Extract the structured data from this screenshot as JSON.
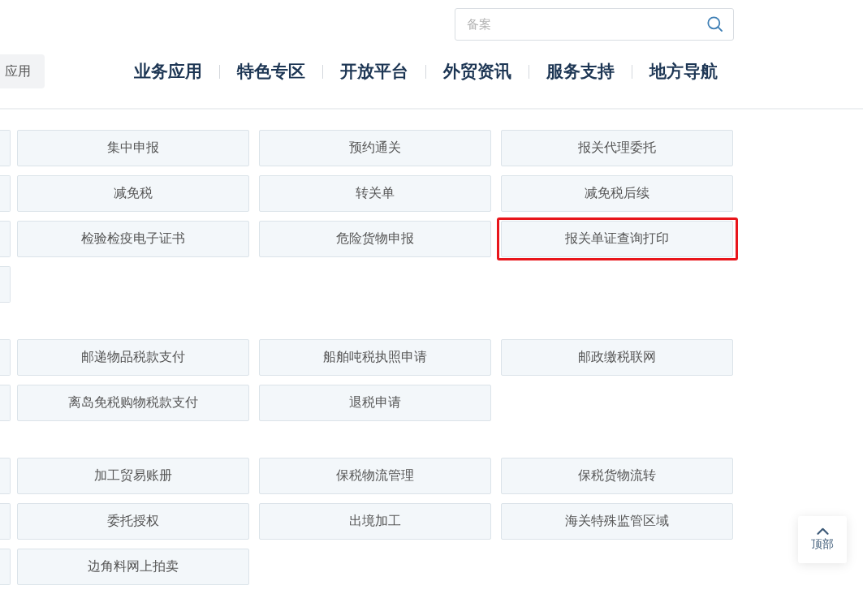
{
  "search": {
    "placeholder": "备案"
  },
  "category_tab": {
    "label": "应用"
  },
  "nav": [
    "业务应用",
    "特色专区",
    "开放平台",
    "外贸资讯",
    "服务支持",
    "地方导航"
  ],
  "groups": [
    {
      "rows": [
        {
          "cells": [
            {
              "kind": "clipped"
            },
            {
              "kind": "tile",
              "label": "集中申报",
              "highlighted": false
            },
            {
              "kind": "tile",
              "label": "预约通关",
              "highlighted": false
            },
            {
              "kind": "tile",
              "label": "报关代理委托",
              "highlighted": false
            }
          ]
        },
        {
          "cells": [
            {
              "kind": "clipped"
            },
            {
              "kind": "tile",
              "label": "减免税",
              "highlighted": false
            },
            {
              "kind": "tile",
              "label": "转关单",
              "highlighted": false
            },
            {
              "kind": "tile",
              "label": "减免税后续",
              "highlighted": false
            }
          ]
        },
        {
          "cells": [
            {
              "kind": "clipped"
            },
            {
              "kind": "tile",
              "label": "检验检疫电子证书",
              "highlighted": false
            },
            {
              "kind": "tile",
              "label": "危险货物申报",
              "highlighted": false
            },
            {
              "kind": "tile",
              "label": "报关单证查询打印",
              "highlighted": true
            }
          ]
        },
        {
          "cells": [
            {
              "kind": "clipped"
            }
          ]
        }
      ]
    },
    {
      "rows": [
        {
          "cells": [
            {
              "kind": "clipped"
            },
            {
              "kind": "tile",
              "label": "邮递物品税款支付",
              "highlighted": false
            },
            {
              "kind": "tile",
              "label": "船舶吨税执照申请",
              "highlighted": false
            },
            {
              "kind": "tile",
              "label": "邮政缴税联网",
              "highlighted": false
            }
          ]
        },
        {
          "cells": [
            {
              "kind": "clipped"
            },
            {
              "kind": "tile",
              "label": "离岛免税购物税款支付",
              "highlighted": false
            },
            {
              "kind": "tile",
              "label": "退税申请",
              "highlighted": false
            }
          ]
        }
      ]
    },
    {
      "rows": [
        {
          "cells": [
            {
              "kind": "clipped"
            },
            {
              "kind": "tile",
              "label": "加工贸易账册",
              "highlighted": false
            },
            {
              "kind": "tile",
              "label": "保税物流管理",
              "highlighted": false
            },
            {
              "kind": "tile",
              "label": "保税货物流转",
              "highlighted": false
            }
          ]
        },
        {
          "cells": [
            {
              "kind": "clipped"
            },
            {
              "kind": "tile",
              "label": "委托授权",
              "highlighted": false
            },
            {
              "kind": "tile",
              "label": "出境加工",
              "highlighted": false
            },
            {
              "kind": "tile",
              "label": "海关特殊监管区域",
              "highlighted": false
            }
          ]
        },
        {
          "cells": [
            {
              "kind": "clipped"
            },
            {
              "kind": "tile",
              "label": "边角料网上拍卖",
              "highlighted": false
            }
          ]
        }
      ]
    }
  ],
  "back_to_top": {
    "label": "顶部"
  }
}
